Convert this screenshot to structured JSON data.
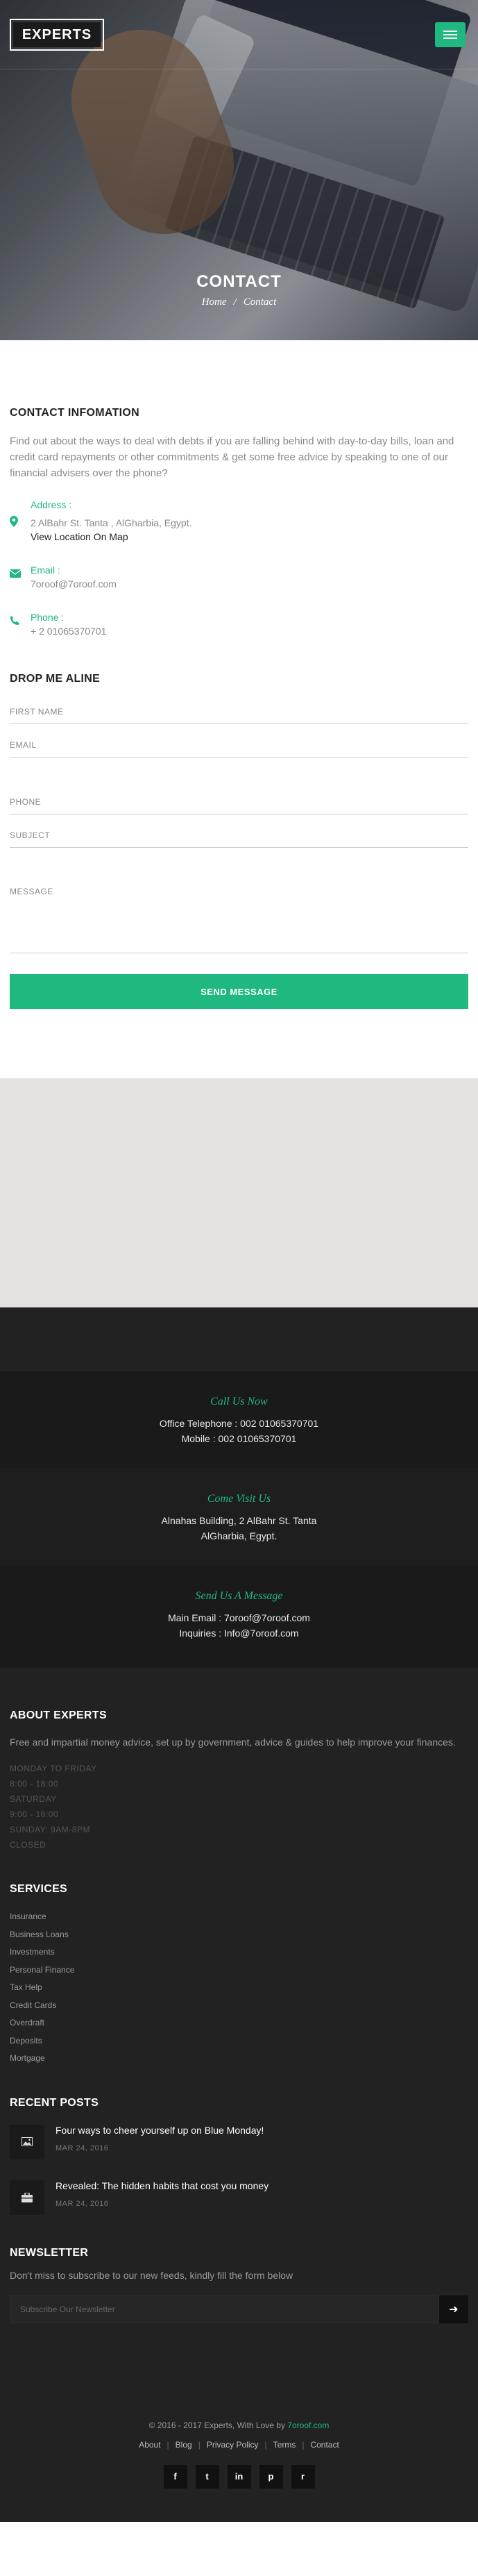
{
  "header": {
    "logo_text": "EXPERTS",
    "menu_icon": "hamburger-menu-icon",
    "page_title": "CONTACT",
    "breadcrumb": {
      "home": "Home",
      "separator": "/",
      "current": "Contact"
    }
  },
  "contact_info": {
    "heading": "CONTACT INFOMATION",
    "lead": "Find out about the ways to deal with debts if you are falling behind with day-to-day bills, loan and credit card repayments or other commitments & get some free advice by speaking to one of our financial advisers over the phone?",
    "address": {
      "label": "Address :",
      "value": "2 AlBahr St. Tanta , AlGharbia, Egypt.",
      "link": "View Location On Map"
    },
    "email": {
      "label": "Email :",
      "value": "7oroof@7oroof.com"
    },
    "phone": {
      "label": "Phone :",
      "value": "+ 2 01065370701"
    }
  },
  "form": {
    "heading": "DROP ME ALINE",
    "first_name": "FIRST NAME",
    "email": "EMAIL",
    "phone": "PHONE",
    "subject": "SUBJECT",
    "message": "MESSAGE",
    "submit": "SEND MESSAGE"
  },
  "call_boxes": [
    {
      "title": "Call Us Now",
      "lines": [
        "Office Telephone : 002 01065370701",
        "Mobile : 002 01065370701"
      ]
    },
    {
      "title": "Come Visit Us",
      "lines": [
        "Alnahas Building, 2 AlBahr St. Tanta",
        "AlGharbia, Egypt."
      ]
    },
    {
      "title": "Send Us A Message",
      "lines": [
        "Main Email : 7oroof@7oroof.com",
        "Inquiries : Info@7oroof.com"
      ]
    }
  ],
  "about": {
    "heading": "ABOUT EXPERTS",
    "text": "Free and impartial money advice, set up by government, advice & guides to help improve your finances.",
    "hours": [
      "MONDAY TO FRIDAY",
      "8:00 - 18:00",
      "SATURDAY",
      "9:00 - 16:00",
      "SUNDAY: 9AM-8PM",
      "CLOSED"
    ]
  },
  "services": {
    "heading": "SERVICES",
    "items": [
      "Insurance",
      "Business Loans",
      "Investments",
      "Personal Finance",
      "Tax Help",
      "Credit Cards",
      "Overdraft",
      "Deposits",
      "Mortgage"
    ]
  },
  "recent_posts": {
    "heading": "RECENT POSTS",
    "items": [
      {
        "title": "Four ways to cheer yourself up on Blue Monday!",
        "date": "MAR 24, 2016",
        "icon": "image-icon"
      },
      {
        "title": "Revealed: The hidden habits that cost you money",
        "date": "MAR 24, 2016",
        "icon": "briefcase-icon"
      }
    ]
  },
  "newsletter": {
    "heading": "NEWSLETTER",
    "text": "Don't miss to subscribe to our new feeds, kindly fill the form below",
    "placeholder": "Subscribe Our Newsletter",
    "button_icon": "arrow-right-icon"
  },
  "footer": {
    "copyright_prefix": "© 2016 - 2017 Experts, With Love by",
    "copyright_link": "7oroof.com",
    "nav": [
      "About",
      "Blog",
      "Privacy Policy",
      "Terms",
      "Contact"
    ],
    "socials": [
      {
        "name": "facebook-icon",
        "glyph": "f"
      },
      {
        "name": "twitter-icon",
        "glyph": "t"
      },
      {
        "name": "linkedin-icon",
        "glyph": "in"
      },
      {
        "name": "pinterest-icon",
        "glyph": "p"
      },
      {
        "name": "rss-icon",
        "glyph": "r"
      }
    ]
  },
  "colors": {
    "accent": "#1fb87f",
    "dark": "#222222",
    "darker": "#1a1a1a",
    "map": "#e5e3df"
  }
}
